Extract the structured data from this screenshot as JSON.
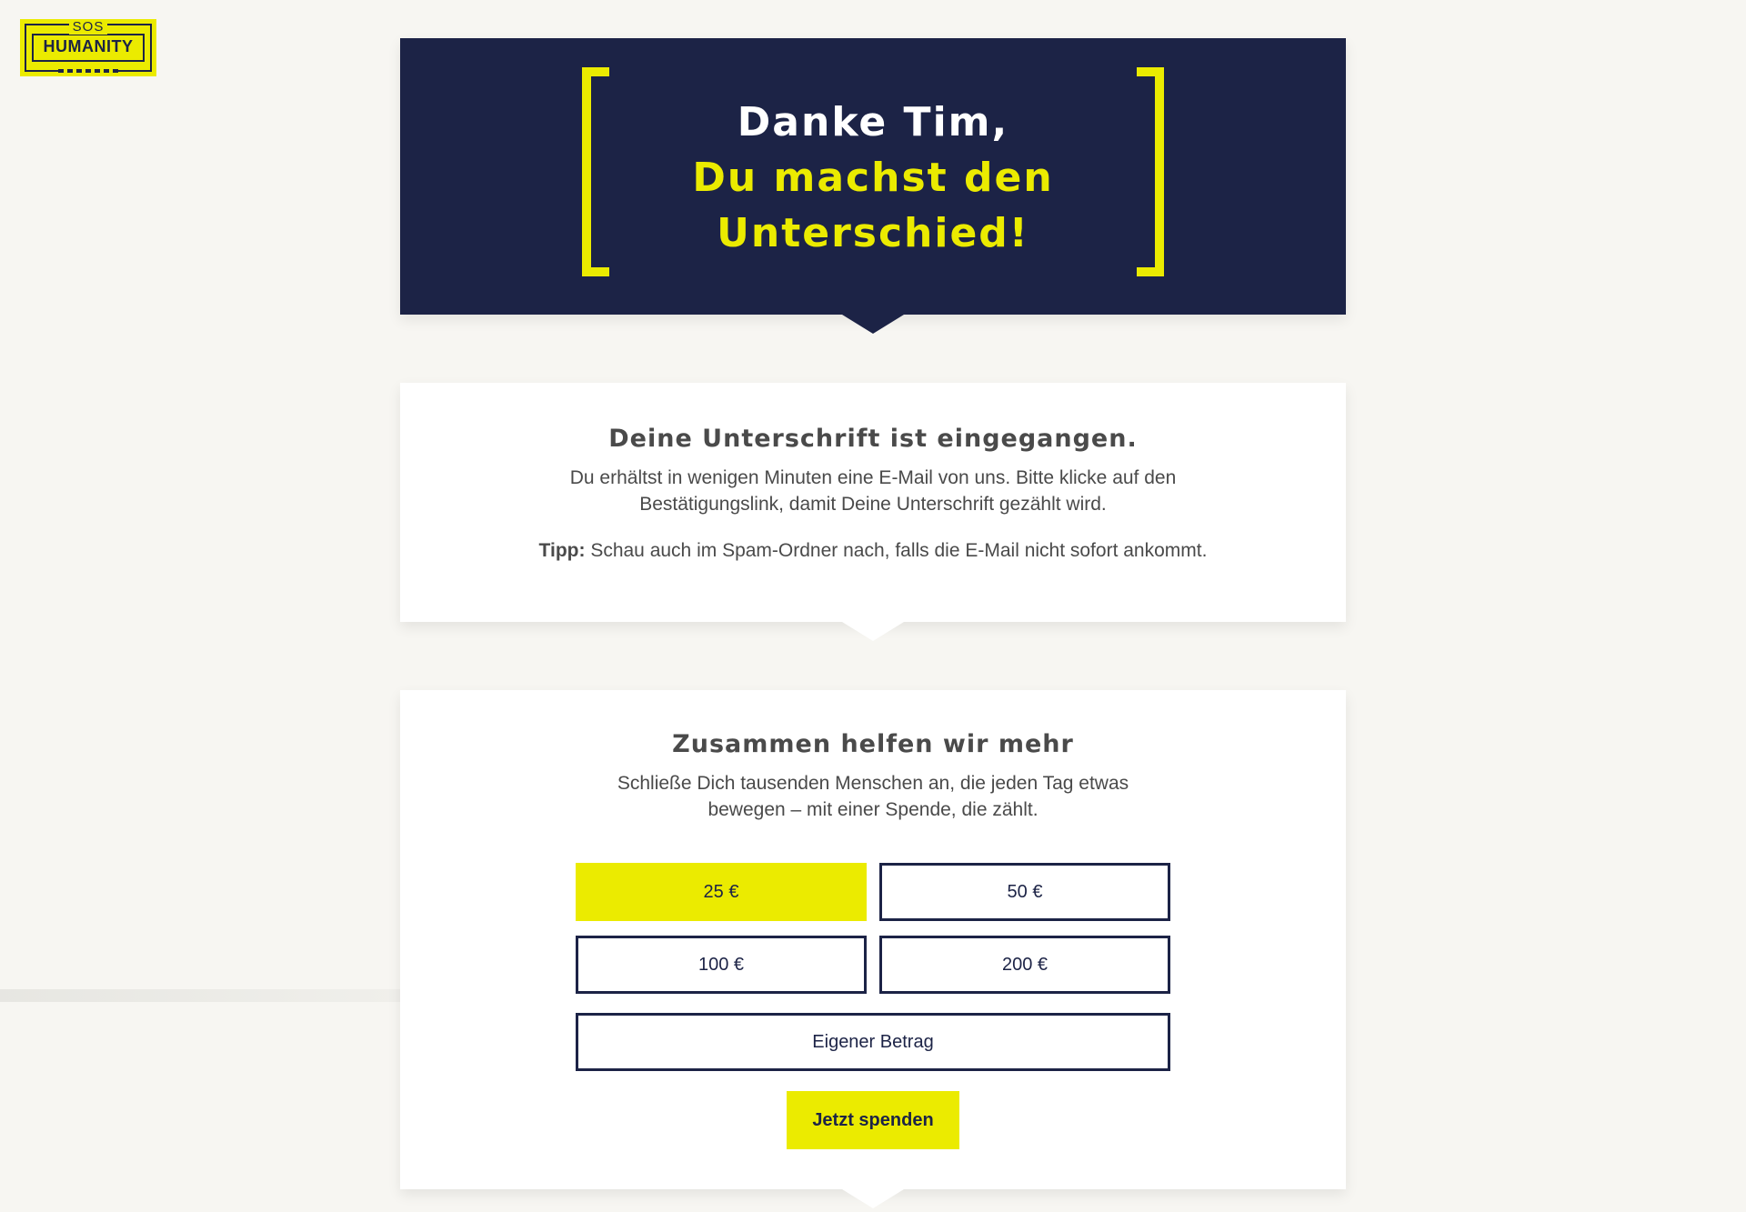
{
  "logo": {
    "top": "SOS",
    "main": "HUMANITY"
  },
  "hero": {
    "line1": "Danke Tim,",
    "line2": "Du machst den",
    "line3": "Unterschied!"
  },
  "confirmation": {
    "title": "Deine Unterschrift ist eingegangen.",
    "body": "Du erhältst in wenigen Minuten eine E-Mail von uns. Bitte klicke auf den Bestätigungslink, damit Deine Unterschrift gezählt wird.",
    "tip_label": "Tipp:",
    "tip_text": " Schau auch im Spam-Ordner nach, falls die E-Mail nicht sofort ankommt."
  },
  "donation": {
    "title": "Zusammen helfen wir mehr",
    "body": "Schließe Dich tausenden Menschen an, die jeden Tag etwas bewegen – mit einer Spende, die zählt.",
    "amounts": [
      "25 €",
      "50 €",
      "100 €",
      "200 €"
    ],
    "selected_amount": "25 €",
    "custom_label": "Eigener Betrag",
    "submit_label": "Jetzt spenden"
  },
  "colors": {
    "navy": "#1c2346",
    "yellow": "#ebeb00",
    "background": "#f7f6f2"
  }
}
